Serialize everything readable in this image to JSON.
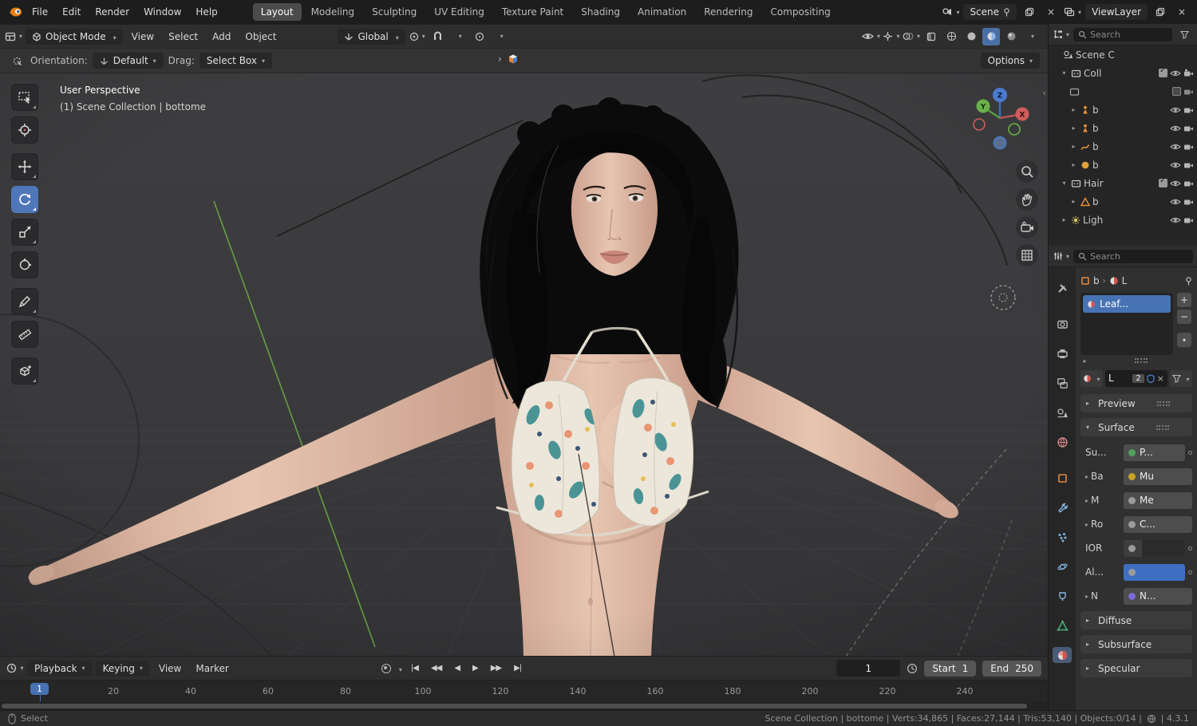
{
  "topbar": {
    "menus": [
      "File",
      "Edit",
      "Render",
      "Window",
      "Help"
    ],
    "workspaces": [
      "Layout",
      "Modeling",
      "Sculpting",
      "UV Editing",
      "Texture Paint",
      "Shading",
      "Animation",
      "Rendering",
      "Compositing"
    ],
    "scene_name": "Scene",
    "viewlayer_name": "ViewLayer"
  },
  "header": {
    "mode": "Object Mode",
    "menus": [
      "View",
      "Select",
      "Add",
      "Object"
    ],
    "orientation": "Global"
  },
  "tools": {
    "orientation_label": "Orientation:",
    "orientation_value": "Default",
    "drag_label": "Drag:",
    "drag_value": "Select Box",
    "options_label": "Options"
  },
  "viewport": {
    "line1": "User Perspective",
    "line2": "(1) Scene Collection | bottome",
    "axis_x": "X",
    "axis_y": "Y",
    "axis_z": "Z"
  },
  "timeline": {
    "playback": "Playback",
    "keying": "Keying",
    "view": "View",
    "marker": "Marker",
    "frame": "1",
    "start_label": "Start",
    "start_value": "1",
    "end_label": "End",
    "end_value": "250",
    "playhead": "1",
    "ruler": [
      "20",
      "40",
      "60",
      "80",
      "100",
      "120",
      "140",
      "160",
      "180",
      "200",
      "220",
      "240"
    ]
  },
  "status": {
    "left": "Select",
    "stats": "Scene Collection | bottome | Verts:34,865 | Faces:27,144 | Tris:53,140 | Objects:0/14 |",
    "version": "| 4.3.1"
  },
  "outliner": {
    "search": "Search",
    "rows": [
      {
        "label": "Scene C"
      },
      {
        "label": "Coll"
      },
      {
        "label": ""
      },
      {
        "label": "b"
      },
      {
        "label": "b"
      },
      {
        "label": "b"
      },
      {
        "label": "b"
      },
      {
        "label": "Hair"
      },
      {
        "label": "b"
      },
      {
        "label": "Ligh"
      }
    ]
  },
  "props": {
    "search": "Search",
    "crumb_object": "b",
    "crumb_mat": "L",
    "slot": "Leaf...",
    "mat_name": "L",
    "mat_users": "2",
    "preview": "Preview",
    "surface": "Surface",
    "rows": [
      {
        "label": "Su...",
        "value": "P..."
      },
      {
        "label": "Ba",
        "value": "Mu"
      },
      {
        "label": "M",
        "value": "Me"
      },
      {
        "label": "Ro",
        "value": "C..."
      },
      {
        "label": "IOR",
        "value": ""
      },
      {
        "label": "Al...",
        "value": ""
      },
      {
        "label": "N",
        "value": "N..."
      }
    ],
    "diffuse": "Diffuse",
    "subsurface": "Subsurface",
    "specular": "Specular"
  }
}
